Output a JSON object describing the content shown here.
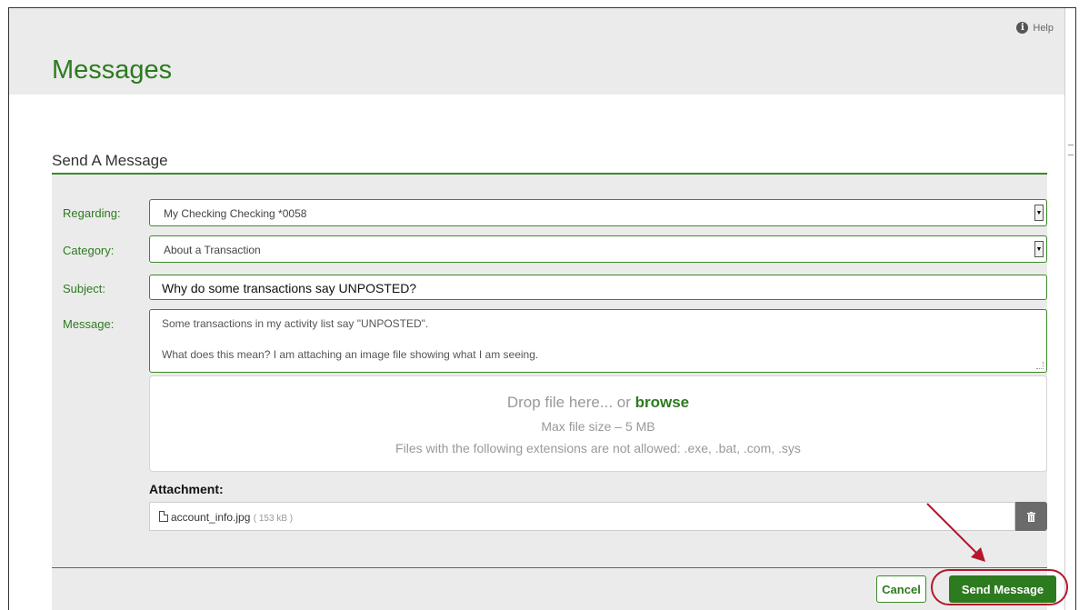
{
  "header": {
    "title": "Messages",
    "help_label": "Help",
    "help_icon": "info-icon"
  },
  "section": {
    "title": "Send A Message"
  },
  "form": {
    "regarding": {
      "label": "Regarding:",
      "value": "My Checking Checking *0058"
    },
    "category": {
      "label": "Category:",
      "value": "About a Transaction"
    },
    "subject": {
      "label": "Subject:",
      "value": "Why do some transactions say UNPOSTED?"
    },
    "message": {
      "label": "Message:",
      "line1": "Some transactions in my activity list say \"UNPOSTED\".",
      "line2": "What does this mean? I am attaching an image file showing what I am seeing."
    }
  },
  "dropzone": {
    "prompt": "Drop file here... or",
    "browse": "browse",
    "max_size": "Max file size – 5 MB",
    "restriction": "Files with the following extensions are not allowed: .exe, .bat, .com, .sys"
  },
  "attachment": {
    "label": "Attachment:",
    "file_name": "account_info.jpg",
    "file_size": "( 153 kB )",
    "file_icon": "file-icon",
    "delete_icon": "trash-icon"
  },
  "footer": {
    "cancel_label": "Cancel",
    "send_label": "Send Message"
  },
  "colors": {
    "brand_green": "#2d7a1f",
    "annotation_red": "#b5172b",
    "panel_gray": "#ebebeb"
  }
}
